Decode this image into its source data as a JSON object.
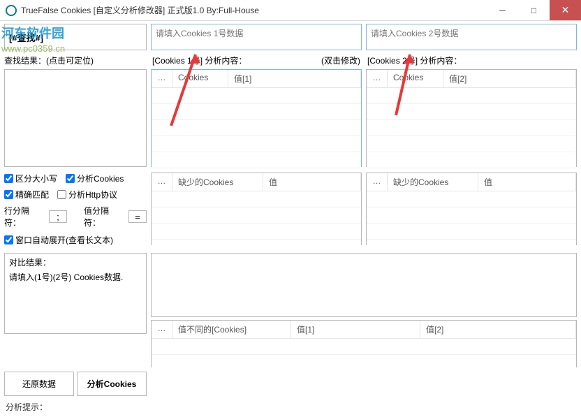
{
  "window": {
    "title": "TrueFalse Cookies [自定义分析修改器] 正式版1.0        By:Full-House"
  },
  "watermark": {
    "site": "河东软件园",
    "url": "www.pc0359.cn"
  },
  "search": {
    "placeholder": "[#查找#]"
  },
  "cookie1": {
    "placeholder": "请填入Cookies 1号数据"
  },
  "cookie2": {
    "placeholder": "请填入Cookies 2号数据"
  },
  "labels": {
    "search_result": "查找结果：(点击可定位)",
    "analysis1": "[Cookies 1号] 分析内容：",
    "dbl_click": "(双击修改)",
    "analysis2": "[Cookies 2号] 分析内容：",
    "compare_result": "对比结果：",
    "compare_hint": "请填入(1号)(2号) Cookies数据.",
    "status": "分析提示："
  },
  "grid": {
    "dash": "…",
    "cookies": "Cookies",
    "val1": "值[1]",
    "val2": "值[2]",
    "missing_col": "缺少的Cookies",
    "missing_val": "值",
    "diff_col": "值不同的[Cookies]"
  },
  "options": {
    "case_sensitive": "区分大小写",
    "analyze_cookies": "分析Cookies",
    "exact_match": "精确匹配",
    "analyze_http": "分析Http协议",
    "row_sep_label": "行分隔符：",
    "row_sep_value": ";",
    "val_sep_label": "值分隔符：",
    "val_sep_value": "=",
    "auto_expand": "窗口自动展开(查看长文本)"
  },
  "buttons": {
    "restore": "还原数据",
    "analyze": "分析Cookies"
  }
}
